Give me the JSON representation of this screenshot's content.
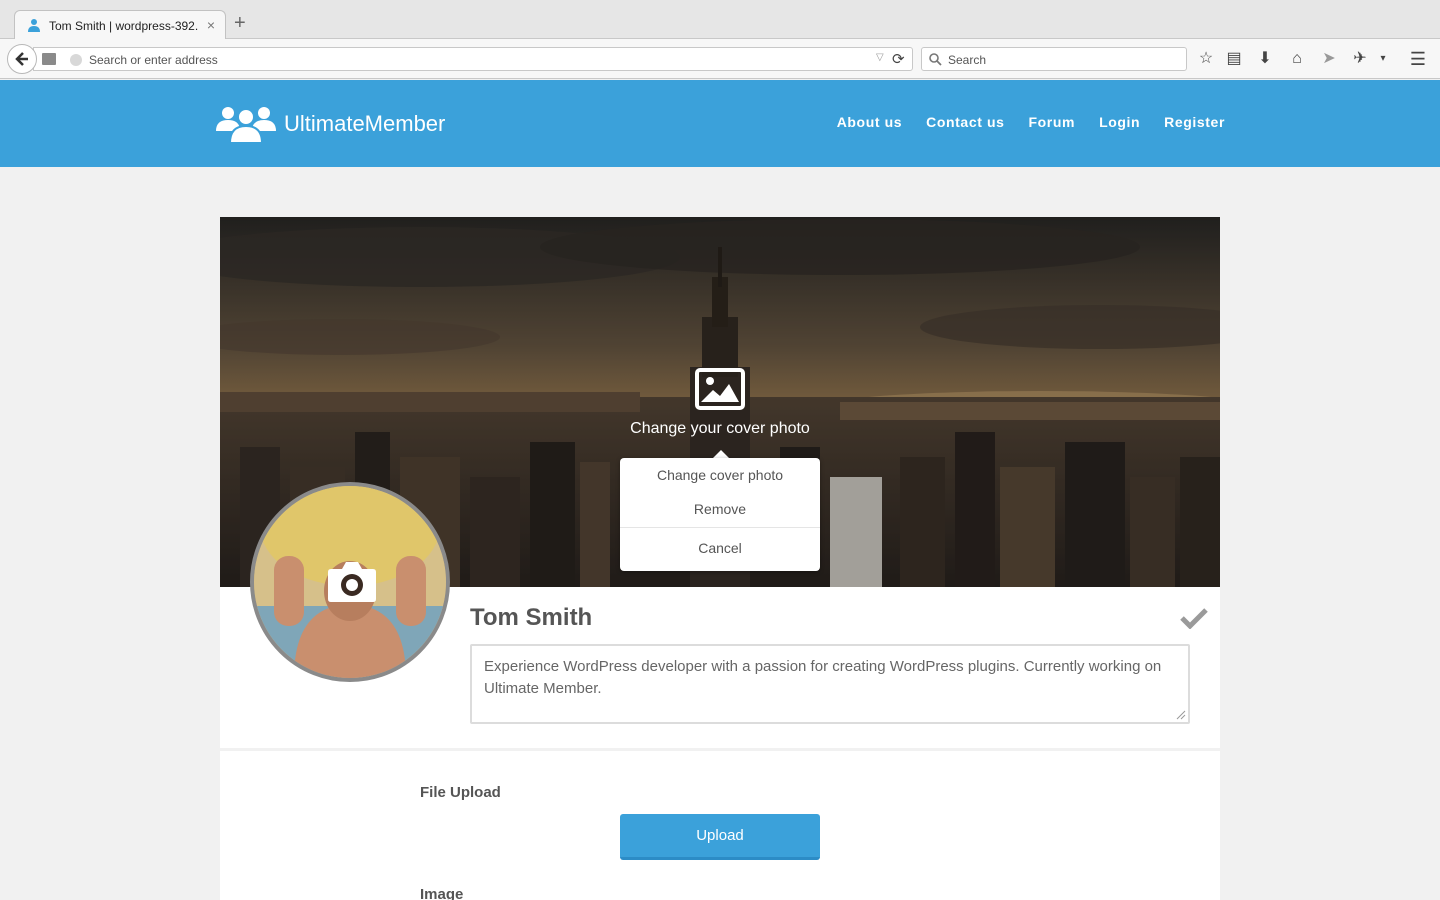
{
  "browser": {
    "tab_title": "Tom Smith | wordpress-392...",
    "tab_close": "×",
    "new_tab": "+",
    "address_placeholder": "Search or enter address",
    "search_placeholder": "Search"
  },
  "site": {
    "logo_text": "UltimateMember",
    "nav": [
      "About us",
      "Contact us",
      "Forum",
      "Login",
      "Register"
    ],
    "accent_color": "#3ba1da"
  },
  "cover": {
    "overlay_text": "Change your cover photo",
    "menu": {
      "change": "Change cover photo",
      "remove": "Remove",
      "cancel": "Cancel"
    }
  },
  "profile": {
    "name": "Tom Smith",
    "bio": "Experience WordPress developer with a passion for creating WordPress plugins. Currently working on Ultimate Member."
  },
  "fields": {
    "file_upload_label": "File Upload",
    "upload_button": "Upload",
    "image_label": "Image"
  },
  "icons": [
    "user-icon",
    "back-arrow-icon",
    "reload-icon",
    "search-icon",
    "star-icon",
    "reading-list-icon",
    "download-icon",
    "home-icon",
    "send-icon",
    "pocket-icon",
    "menu-icon",
    "users-logo-icon",
    "image-icon",
    "camera-icon",
    "checkmark-icon"
  ]
}
